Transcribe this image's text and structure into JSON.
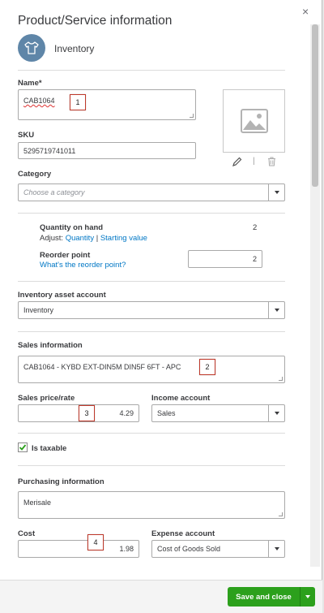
{
  "header": {
    "title": "Product/Service information",
    "close_glyph": "×",
    "type_label": "Inventory",
    "type_icon": "tshirt-icon"
  },
  "name": {
    "label": "Name*",
    "value": "CAB1064"
  },
  "sku": {
    "label": "SKU",
    "value": "5295719741011"
  },
  "category": {
    "label": "Category",
    "placeholder": "Choose a category"
  },
  "quantity": {
    "label": "Quantity on hand",
    "value": "2",
    "adjust_label": "Adjust:",
    "adjust_quantity_link": "Quantity",
    "adjust_sep": "|",
    "starting_value_link": "Starting value"
  },
  "reorder": {
    "label": "Reorder point",
    "help_link": "What's the reorder point?",
    "value": "2"
  },
  "inventory_asset": {
    "label": "Inventory asset account",
    "value": "Inventory"
  },
  "sales": {
    "label": "Sales information",
    "description": "CAB1064 - KYBD EXT-DIN5M DIN5F 6FT - APC",
    "price_label": "Sales price/rate",
    "price_value": "4.29",
    "income_label": "Income account",
    "income_value": "Sales"
  },
  "taxable": {
    "label": "Is taxable",
    "checked": true
  },
  "purchasing": {
    "label": "Purchasing information",
    "description": "Merisale",
    "cost_label": "Cost",
    "cost_value": "1.98",
    "expense_label": "Expense account",
    "expense_value": "Cost of Goods Sold"
  },
  "image_actions": {
    "edit_icon": "pencil-icon",
    "divider": "|",
    "delete_icon": "trash-icon"
  },
  "markers": [
    "1",
    "2",
    "3",
    "4"
  ],
  "footer": {
    "save_label": "Save and close"
  },
  "colors": {
    "accent_green": "#2ca01c",
    "link_blue": "#0077c5",
    "icon_circle": "#5f86a8"
  }
}
